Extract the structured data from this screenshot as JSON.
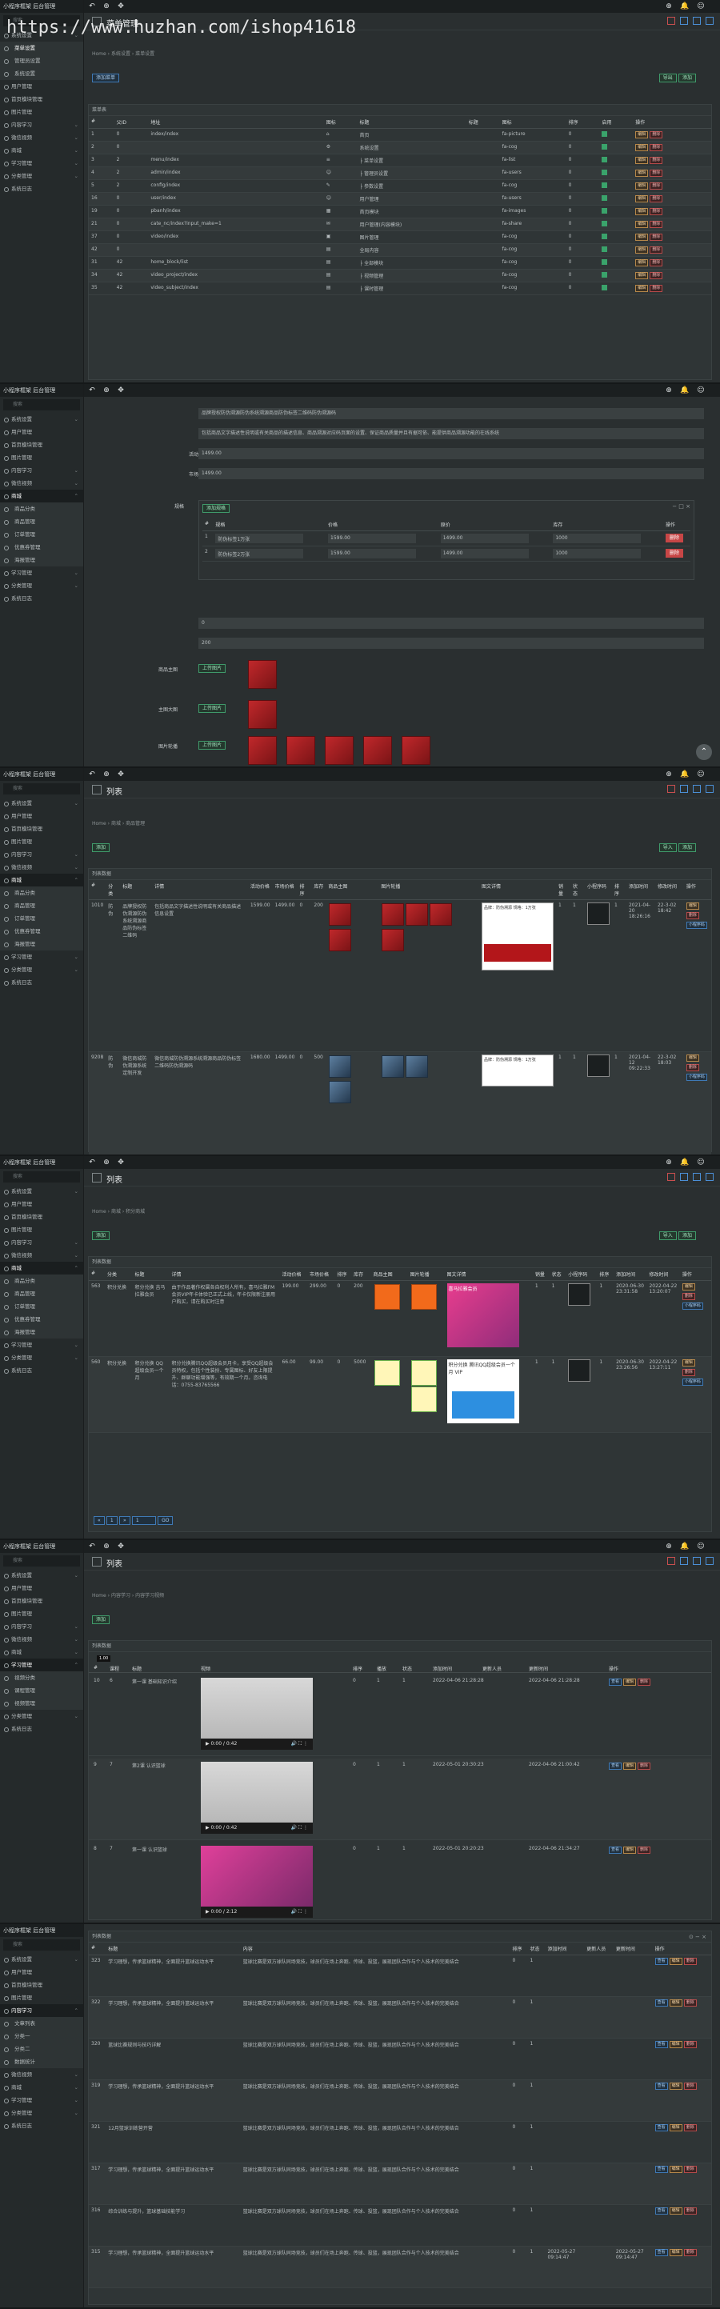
{
  "watermark": "https://www.huzhan.com/ishop41618",
  "brand": "小程序框架 ",
  "brand_sub": "后台管理",
  "search_placeholder": "搜索",
  "menu": {
    "home": "后台首页",
    "system_settings": "系统设置",
    "admin_settings": "管理员设置",
    "menu_settings": "菜单设置",
    "user_manage": "用户管理",
    "home_modules": "首页模块管理",
    "image_manage": "图片管理",
    "article_list": "文章列表",
    "poster_setting": "海报管理",
    "mall": "商城",
    "product_category": "商品分类",
    "product_manage": "商品管理",
    "order_manage": "订单管理",
    "coupon_manage": "优惠券管理",
    "content": "内容学习",
    "video_manage": "视频管理",
    "study_manage": "学习管理",
    "video_cat": "视频分类",
    "course": "课程管理",
    "category_manage": "分类管理",
    "micro_video": "微信视频",
    "cat_a": "分类一",
    "cat_b": "分类二",
    "data_stats": "数据统计",
    "system_log": "系统日志"
  },
  "panel1": {
    "title": "菜单管理",
    "breadcrumb": [
      "Home",
      "系统设置",
      "菜单设置"
    ],
    "add_button": "添加菜单",
    "card_title": "菜单表",
    "export": "导出",
    "add": "添加",
    "columns": [
      "#",
      "父ID",
      "地址",
      "图标",
      "标题",
      "标题",
      "图标",
      "排序",
      "启用",
      "操作"
    ],
    "rows": [
      [
        "1",
        "0",
        "index/index",
        "⌂",
        "首页",
        "",
        "fa-picture",
        "0"
      ],
      [
        "2",
        "0",
        "",
        "⚙",
        "系统设置",
        "",
        "fa-cog",
        "0"
      ],
      [
        "3",
        "2",
        "menu/index",
        "≡",
        "├ 菜单设置",
        "",
        "fa-list",
        "0"
      ],
      [
        "4",
        "2",
        "admin/index",
        "☺",
        "├ 管理员设置",
        "",
        "fa-users",
        "0"
      ],
      [
        "5",
        "2",
        "config/index",
        "✎",
        "├ 参数设置",
        "",
        "fa-cog",
        "0"
      ],
      [
        "16",
        "0",
        "user/index",
        "☺",
        "用户管理",
        "",
        "fa-users",
        "0"
      ],
      [
        "19",
        "0",
        "pbanh/index",
        "▦",
        "首页模块",
        "",
        "fa-images",
        "0"
      ],
      [
        "21",
        "0",
        "cate_nc/index?input_make=1",
        "✉",
        "用户管理(内容模块)",
        "",
        "fa-share",
        "0"
      ],
      [
        "37",
        "0",
        "video/index",
        "▣",
        "图片管理",
        "",
        "fa-cog",
        "0"
      ],
      [
        "42",
        "0",
        "",
        "▤",
        "全局内容",
        "",
        "fa-cog",
        "0"
      ],
      [
        "31",
        "42",
        "home_block/list",
        "▤",
        "├ 全部模块",
        "",
        "fa-cog",
        "0"
      ],
      [
        "34",
        "42",
        "video_project/index",
        "▤",
        "├ 视频管理",
        "",
        "fa-cog",
        "0"
      ],
      [
        "35",
        "42",
        "video_subject/index",
        "▤",
        "├ 课时管理",
        "",
        "fa-cog",
        "0"
      ]
    ],
    "row_ops": [
      "编辑",
      "删除"
    ]
  },
  "panel2": {
    "fields": [
      {
        "label": "标题",
        "value": "品牌授权防伪溯源防伪系统溯源商品防伪标签二维码防伪溯源码"
      },
      {
        "label": "详情",
        "value": "包括商品文字描述性说明或有关商品的描述信息、商品溯源对应码页面的设置、保证商品质量并且有据可依、能提供商品溯源功能的在线系统"
      },
      {
        "label": "活动价格",
        "value": "1499.00"
      },
      {
        "label": "市场价格",
        "value": "1499.00"
      }
    ],
    "spec_label": "规格",
    "spec_add": "添加规格",
    "spec_columns": [
      "#",
      "规格",
      "价格",
      "原价",
      "库存",
      "操作"
    ],
    "spec_rows": [
      [
        "1",
        "防伪标签1万张",
        "1599.00",
        "1499.00",
        "1000"
      ],
      [
        "2",
        "防伪标签2万张",
        "1599.00",
        "1499.00",
        "1000"
      ]
    ],
    "spec_delete": "删除",
    "sort_label": "排序",
    "sort_value": "0",
    "stock_label": "库存",
    "stock_value": "200",
    "cover_label": "商品主图",
    "cover_btn": "上传图片",
    "main_label": "主图大图",
    "gallery_label": "图片轮播"
  },
  "panel3": {
    "title": "列表",
    "breadcrumb": [
      "Home",
      "商城",
      "商品管理"
    ],
    "add_button": "添加",
    "export": "导入",
    "add2": "添加",
    "card_title": "列表数据",
    "columns": [
      "#",
      "分类",
      "标题",
      "详情",
      "活动价格",
      "市场价格",
      "排序",
      "库存",
      "商品主图",
      "图片轮播",
      "图文详情",
      "销量",
      "状态",
      "小程序码",
      "排序",
      "添加时间",
      "修改时间",
      "操作"
    ],
    "rows": [
      {
        "id": "1010",
        "cat": "防伪",
        "title": "品牌授权防伪溯源防伪系统溯源商品防伪标签二维码",
        "desc": "包括商品文字描述性说明或有关商品描述信息设置",
        "price": "1599.00",
        "market": "1499.00",
        "sort": "0",
        "stock": "200",
        "sales": "1",
        "status": "1",
        "ord": "1",
        "created": "2021-04-20 18:26:16",
        "updated": "22-3-02 18:42"
      },
      {
        "id": "9208",
        "cat": "防伪",
        "title": "微信商城防伪溯源系统定制开发",
        "desc": "微信商城防伪溯源系统溯源商品防伪标签二维码防伪溯源码",
        "price": "1680.00",
        "market": "1499.00",
        "sort": "0",
        "stock": "500",
        "sales": "1",
        "status": "1",
        "ord": "1",
        "created": "2021-04-12 09:22:33",
        "updated": "22-3-02 18:03"
      }
    ],
    "ops": [
      "编辑",
      "删除",
      "小程序码"
    ],
    "detail_text": "品牌：防伪溯源 规格：1万张"
  },
  "panel4": {
    "title": "列表",
    "breadcrumb": [
      "Home",
      "商城",
      "积分商城"
    ],
    "add_button": "添加",
    "export": "导入",
    "add2": "添加",
    "card_title": "列表数据",
    "columns": [
      "#",
      "分类",
      "标题",
      "详情",
      "活动价格",
      "市场价格",
      "排序",
      "库存",
      "商品主图",
      "图片轮播",
      "图文详情",
      "销量",
      "状态",
      "小程序码",
      "排序",
      "添加时间",
      "修改时间",
      "操作"
    ],
    "rows": [
      {
        "id": "563",
        "cat": "积分兑换",
        "title": "积分兑换 吉马拉雅会员",
        "desc": "由于作品著作权属各自权利人所有，喜马拉雅FM会员VIP年卡体验已正式上线，年卡仅限新注册用户购买，请在购买时注意",
        "price": "199.00",
        "market": "299.00",
        "sort": "0",
        "stock": "200",
        "sales": "1",
        "status": "1",
        "ord": "1",
        "created": "2020-06-30 23:31:58",
        "updated": "2022-04-22 13:20:07"
      },
      {
        "id": "560",
        "cat": "积分兑换",
        "title": "积分兑换 QQ超级会员一个月",
        "desc": "积分兑换腾讯QQ超级会员月卡，享受QQ超级会员特权，包括个性装扮、专属图标、好友上限提升、群聊功能增强等，有效期一个月。咨询电话：0755-83765566",
        "price": "66.00",
        "market": "99.00",
        "sort": "0",
        "stock": "5000",
        "sales": "1",
        "status": "1",
        "ord": "1",
        "created": "2020-06-30 23:26:56",
        "updated": "2022-04-22 13:27:11"
      }
    ],
    "ops": [
      "编辑",
      "删除",
      "小程序码"
    ],
    "detail_1": "喜马拉雅会员",
    "detail_2": "积分兑换 腾讯QQ超级会员一个月 VIP",
    "pager": [
      "«",
      "1",
      "»",
      "1",
      "GO"
    ]
  },
  "panel5": {
    "title": "列表",
    "breadcrumb": [
      "Home",
      "内容学习",
      "内容学习视频"
    ],
    "add_button": "添加",
    "card_title": "列表数据",
    "columns": [
      "#",
      "课程",
      "标题",
      "视频",
      "排序",
      "播放",
      "状态",
      "添加时间",
      "更新人员",
      "更新时间",
      "操作"
    ],
    "rows": [
      {
        "id": "10",
        "course": "6",
        "title": "第一课 基础知识介绍",
        "sort": "0",
        "play": "1",
        "status": "1",
        "created": "2022-04-06 21:28:28",
        "updated": "2022-04-06 21:28:28",
        "time": "0:00 / 0:42"
      },
      {
        "id": "9",
        "course": "7",
        "title": "第2课 认识篮球",
        "sort": "0",
        "play": "1",
        "status": "1",
        "created": "2022-05-01 20:30:23",
        "updated": "2022-04-06 21:00:42",
        "time": "0:00 / 0:42"
      },
      {
        "id": "8",
        "course": "7",
        "title": "第一课 认识篮球",
        "sort": "0",
        "play": "1",
        "status": "1",
        "created": "2022-05-01 20:20:23",
        "updated": "2022-04-06 21:34:27",
        "time": "0:00 / 2:12"
      }
    ],
    "ops": [
      "查看",
      "编辑",
      "删除"
    ],
    "tooltip": "1.00"
  },
  "panel6": {
    "card_title": "列表数据",
    "columns": [
      "#",
      "标题",
      "内容",
      "排序",
      "状态",
      "添加时间",
      "更新人员",
      "更新时间",
      "操作"
    ],
    "rows": [
      {
        "id": "323",
        "title": "学习理想，传承篮球精神，全面提升篮球运动水平",
        "content": "篮球比赛是双方球队同场竞技，球员们在场上奔跑、传球、投篮，展现团队合作与个人技术的完美结合",
        "sort": "0",
        "status": "1"
      },
      {
        "id": "322",
        "title": "学习理想，传承篮球精神，全面提升篮球运动水平",
        "content": "篮球比赛是双方球队同场竞技，球员们在场上奔跑、传球、投篮，展现团队合作与个人技术的完美结合",
        "sort": "0",
        "status": "1"
      },
      {
        "id": "320",
        "title": "篮球比赛规则与技巧详解",
        "content": "篮球比赛是双方球队同场竞技，球员们在场上奔跑、传球、投篮，展现团队合作与个人技术的完美结合",
        "sort": "0",
        "status": "1"
      },
      {
        "id": "319",
        "title": "学习理想，传承篮球精神，全面提升篮球运动水平",
        "content": "篮球比赛是双方球队同场竞技，球员们在场上奔跑、传球、投篮，展现团队合作与个人技术的完美结合",
        "sort": "0",
        "status": "1"
      },
      {
        "id": "321",
        "title": "12月篮球训练营开营",
        "content": "篮球比赛是双方球队同场竞技，球员们在场上奔跑、传球、投篮，展现团队合作与个人技术的完美结合",
        "sort": "0",
        "status": "1"
      },
      {
        "id": "317",
        "title": "学习理想，传承篮球精神，全面提升篮球运动水平",
        "content": "篮球比赛是双方球队同场竞技，球员们在场上奔跑、传球、投篮，展现团队合作与个人技术的完美结合",
        "sort": "0",
        "status": "1"
      },
      {
        "id": "316",
        "title": "综合训练与提升，篮球基础技能学习",
        "content": "篮球比赛是双方球队同场竞技，球员们在场上奔跑、传球、投篮，展现团队合作与个人技术的完美结合",
        "sort": "0",
        "status": "1"
      },
      {
        "id": "315",
        "title": "学习理想，传承篮球精神，全面提升篮球运动水平",
        "content": "篮球比赛是双方球队同场竞技，球员们在场上奔跑、传球、投篮，展现团队合作与个人技术的完美结合",
        "sort": "0",
        "status": "1",
        "created": "2022-05-27 09:14:47",
        "updated": "2022-05-27 09:14:47"
      }
    ],
    "ops": [
      "查看",
      "编辑",
      "删除"
    ]
  }
}
